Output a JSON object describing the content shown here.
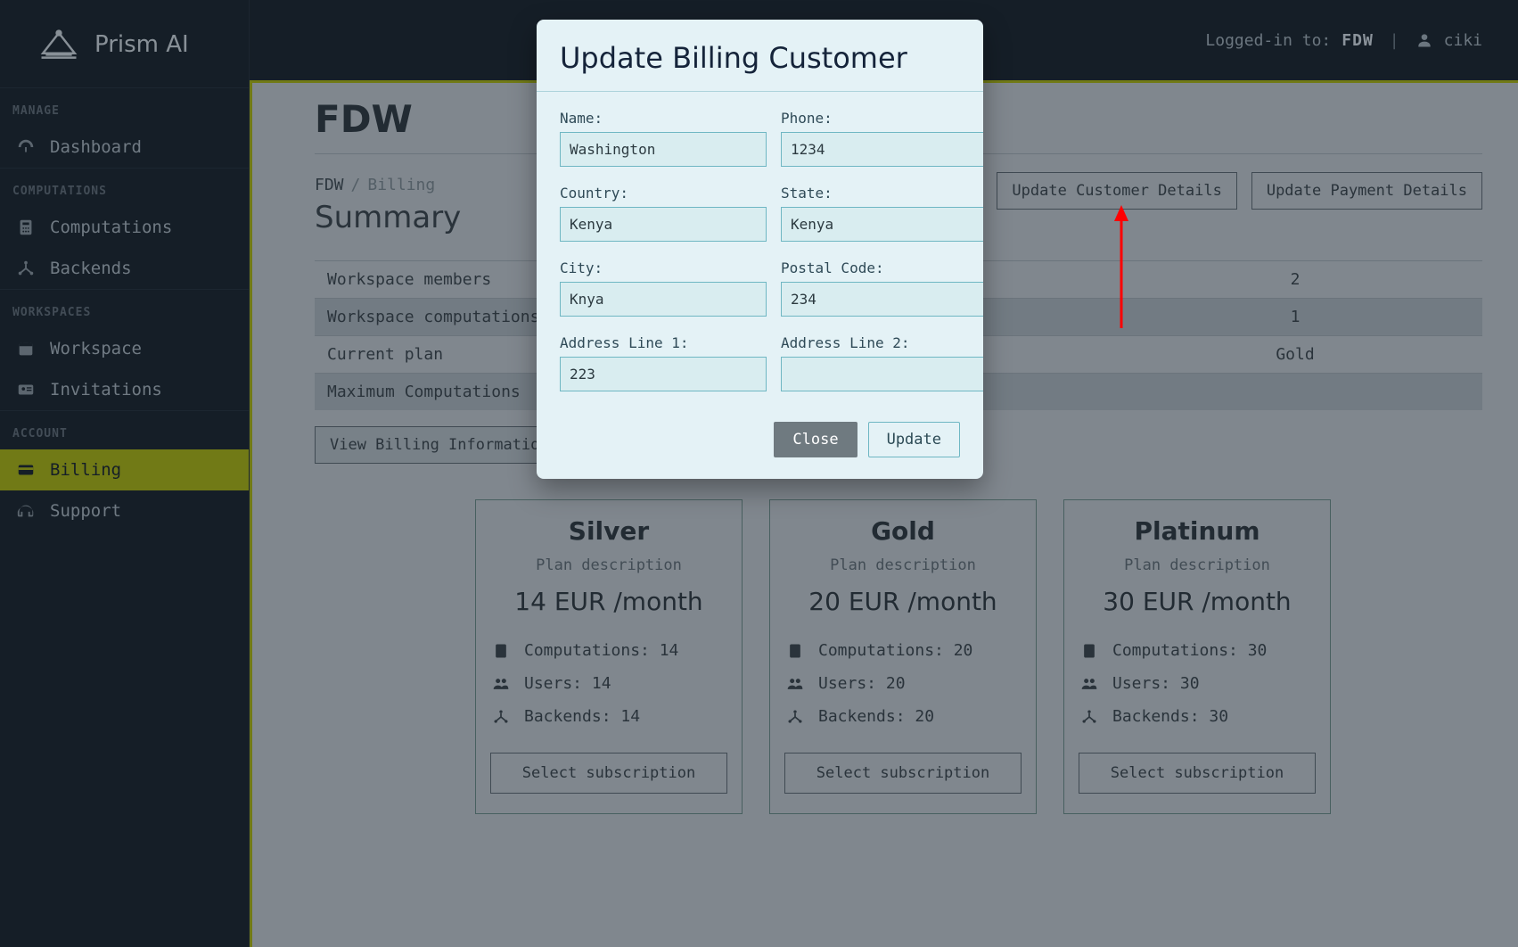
{
  "brand": {
    "name": "Prism AI"
  },
  "header": {
    "logged_in_label": "Logged-in to:",
    "workspace": "FDW",
    "user": "ciki"
  },
  "sidebar": {
    "groups": [
      {
        "label": "MANAGE",
        "items": [
          {
            "icon": "dashboard",
            "label": "Dashboard"
          }
        ]
      },
      {
        "label": "COMPUTATIONS",
        "items": [
          {
            "icon": "calc",
            "label": "Computations"
          },
          {
            "icon": "backend",
            "label": "Backends"
          }
        ]
      },
      {
        "label": "WORKSPACES",
        "items": [
          {
            "icon": "workspace",
            "label": "Workspace"
          },
          {
            "icon": "invite",
            "label": "Invitations"
          }
        ]
      },
      {
        "label": "ACCOUNT",
        "items": [
          {
            "icon": "card",
            "label": "Billing",
            "active": true
          },
          {
            "icon": "support",
            "label": "Support"
          }
        ]
      }
    ]
  },
  "page": {
    "title": "FDW",
    "crumb_root": "FDW",
    "crumb_sep": "/",
    "crumb_leaf": "Billing",
    "section_title": "Summary",
    "buttons": {
      "update_customer": "Update Customer Details",
      "update_payment": "Update Payment Details",
      "view_billing": "View Billing Information"
    },
    "summary": [
      {
        "label": "Workspace members",
        "value": "2"
      },
      {
        "label": "Workspace computations",
        "value": "1"
      },
      {
        "label": "Current plan",
        "value": "Gold"
      },
      {
        "label": "Maximum Computations",
        "value": ""
      }
    ]
  },
  "plans": [
    {
      "name": "Silver",
      "desc": "Plan description",
      "price": "14 EUR /month",
      "feat_comp": "Computations: 14",
      "feat_users": "Users: 14",
      "feat_back": "Backends: 14",
      "cta": "Select subscription"
    },
    {
      "name": "Gold",
      "desc": "Plan description",
      "price": "20 EUR /month",
      "feat_comp": "Computations: 20",
      "feat_users": "Users: 20",
      "feat_back": "Backends: 20",
      "cta": "Select subscription"
    },
    {
      "name": "Platinum",
      "desc": "Plan description",
      "price": "30 EUR /month",
      "feat_comp": "Computations: 30",
      "feat_users": "Users: 30",
      "feat_back": "Backends: 30",
      "cta": "Select subscription"
    }
  ],
  "modal": {
    "title": "Update Billing Customer",
    "fields": {
      "name": {
        "label": "Name:",
        "value": "Washington"
      },
      "phone": {
        "label": "Phone:",
        "value": "1234"
      },
      "country": {
        "label": "Country:",
        "value": "Kenya"
      },
      "state": {
        "label": "State:",
        "value": "Kenya"
      },
      "city": {
        "label": "City:",
        "value": "Knya"
      },
      "postal": {
        "label": "Postal Code:",
        "value": "234"
      },
      "addr1": {
        "label": "Address Line 1:",
        "value": "223"
      },
      "addr2": {
        "label": "Address Line 2:",
        "value": ""
      }
    },
    "close": "Close",
    "update": "Update"
  }
}
